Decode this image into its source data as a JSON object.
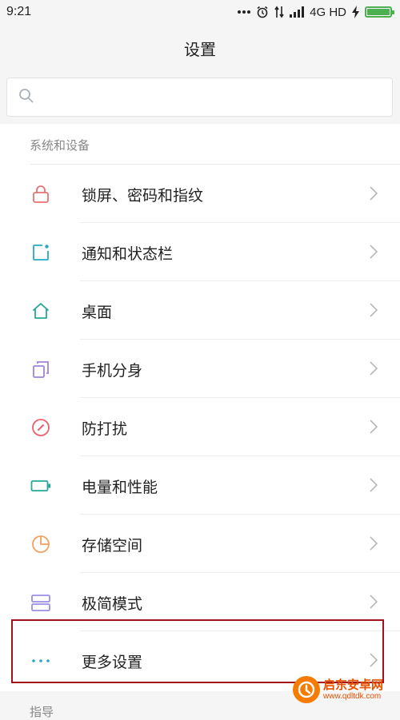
{
  "status_bar": {
    "time": "9:21",
    "network": "4G HD",
    "icons": [
      "more-dots-icon",
      "alarm-clock-icon",
      "data-transfer-icon",
      "signal-icon",
      "charging-icon",
      "battery-icon"
    ]
  },
  "header": {
    "title": "设置"
  },
  "search": {
    "placeholder": "",
    "icon": "search-icon"
  },
  "section": {
    "title": "系统和设备",
    "items": [
      {
        "label": "锁屏、密码和指纹",
        "icon": "lock-icon",
        "color": "#e57373"
      },
      {
        "label": "通知和状态栏",
        "icon": "notification-icon",
        "color": "#26a7c8"
      },
      {
        "label": "桌面",
        "icon": "home-icon",
        "color": "#26a69a"
      },
      {
        "label": "手机分身",
        "icon": "second-space-icon",
        "color": "#a084dc"
      },
      {
        "label": "防打扰",
        "icon": "do-not-disturb-icon",
        "color": "#ec5f6e"
      },
      {
        "label": "电量和性能",
        "icon": "battery-performance-icon",
        "color": "#26a69a"
      },
      {
        "label": "存储空间",
        "icon": "storage-icon",
        "color": "#f4a15d"
      },
      {
        "label": "极简模式",
        "icon": "simple-mode-icon",
        "color": "#9c8ce6"
      },
      {
        "label": "更多设置",
        "icon": "more-settings-icon",
        "color": "#26a7c8"
      }
    ]
  },
  "next_section": {
    "title": "指导"
  },
  "watermark": {
    "title": "启东安卓网",
    "url": "www.qdltdk.com"
  }
}
